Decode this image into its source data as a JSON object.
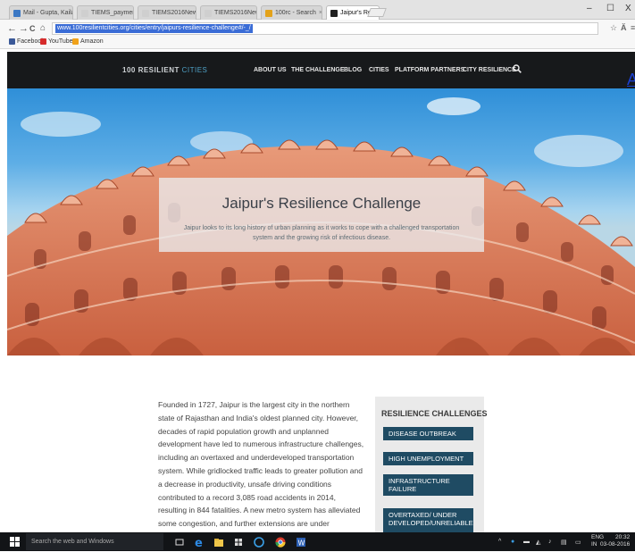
{
  "browser": {
    "tabs": [
      {
        "label": "Mail - Gupta, Kailas",
        "color": "#3b78c4",
        "active": false
      },
      {
        "label": "TIEMS_payment rec",
        "color": "#cfcfcf",
        "active": false
      },
      {
        "label": "TIEMS2016Newslet",
        "color": "#cfcfcf",
        "active": false
      },
      {
        "label": "TIEMS2016Newslet",
        "color": "#cfcfcf",
        "active": false
      },
      {
        "label": "100rc - Search",
        "color": "#e3a21a",
        "active": false
      },
      {
        "label": "Jaipur's Resilience C",
        "color": "#222222",
        "active": true
      }
    ],
    "tab_close": "×",
    "window_controls": {
      "minimize": "–",
      "maximize": "☐",
      "close": "X"
    },
    "nav": {
      "back": "←",
      "forward": "→",
      "reload": "C",
      "home": "⌂"
    },
    "url": "www.100resilientcities.org/cities/entry/jaipurs-resilience-challenge#/-_/",
    "bookmarks": [
      {
        "label": "Facebook",
        "color": "#3b5998"
      },
      {
        "label": "YouTube",
        "color": "#d62b2b"
      },
      {
        "label": "Amazon",
        "color": "#f0a21a"
      }
    ]
  },
  "site": {
    "logo_main": "100 RESILIENT",
    "logo_accent": "CITIES",
    "nav": [
      "ABOUT US",
      "THE CHALLENGE",
      "BLOG",
      "CITIES",
      "PLATFORM PARTNERS",
      "CITY RESILIENCE"
    ],
    "hero_title": "Jaipur's Resilience Challenge",
    "hero_desc": "Jaipur looks to its long history of urban planning as it works to cope with a challenged transportation system and the growing risk of infectious disease.",
    "ext_link": "A",
    "body_text": "Founded in 1727, Jaipur is the largest city in the northern state of Rajasthan and India's oldest planned city. However, decades of rapid population growth and unplanned development have led to numerous infrastructure challenges, including an overtaxed and underdeveloped transportation system. While gridlocked traffic leads to greater pollution and a decrease in productivity, unsafe driving conditions contributed to a record 3,085 road accidents in 2014, resulting in 844 fatalities. A new metro system has alleviated some congestion, and further extensions are under development.",
    "sidebar_title": "RESILIENCE CHALLENGES",
    "challenges": [
      "DISEASE OUTBREAK",
      "HIGH UNEMPLOYMENT",
      "INFRASTRUCTURE FAILURE",
      "OVERTAXED/ UNDER DEVELOPED/UNRELIABLE"
    ]
  },
  "taskbar": {
    "search_placeholder": "Search the web and Windows",
    "lang_top": "ENG",
    "lang_bottom": "IN",
    "time": "20:32",
    "date": "03-08-2016"
  }
}
